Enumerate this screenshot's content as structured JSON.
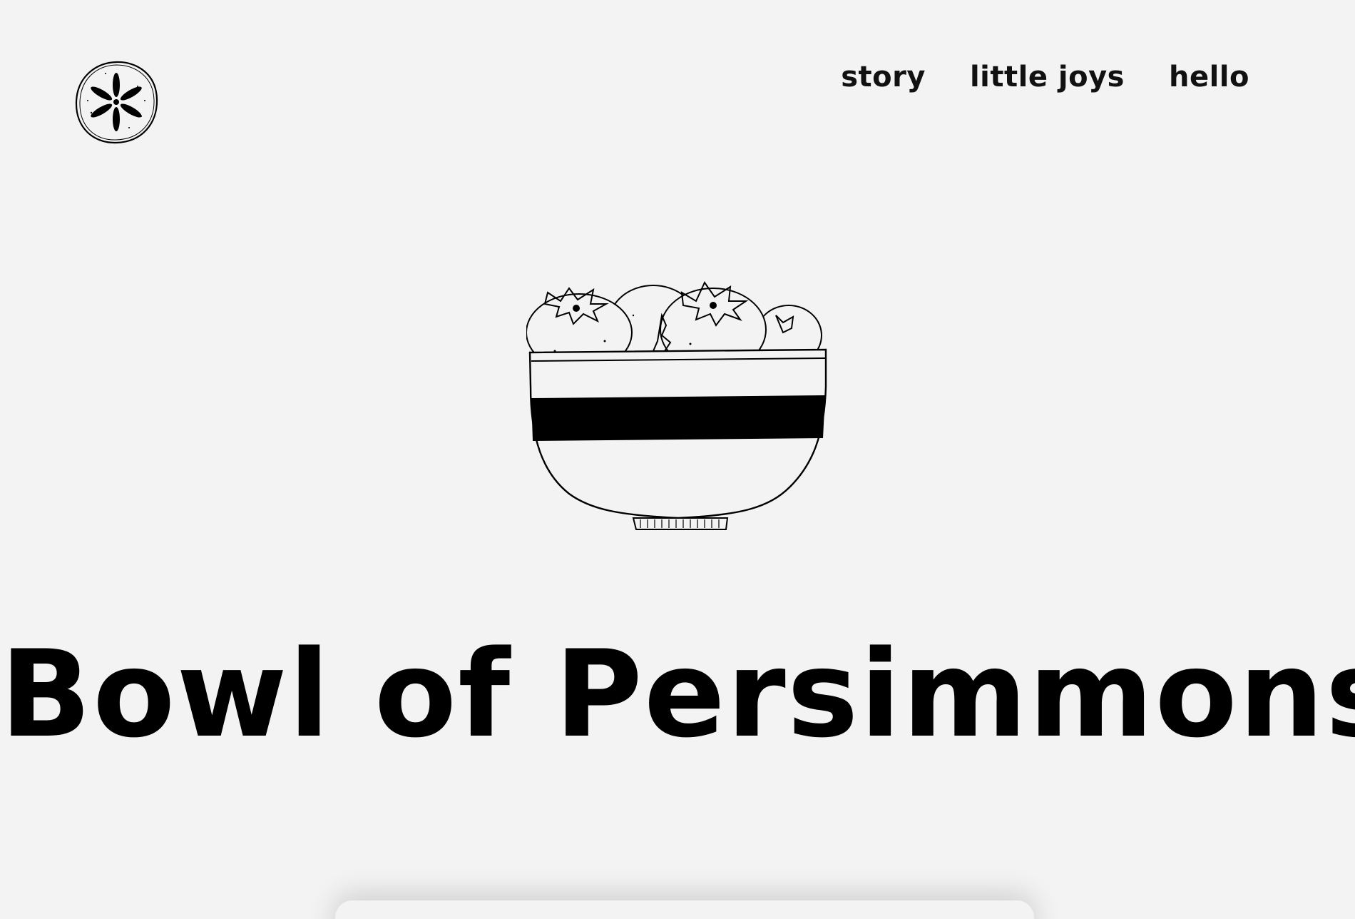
{
  "header": {
    "logo_icon": "persimmon-slice-logo-icon",
    "nav": [
      {
        "label": "story"
      },
      {
        "label": "little joys"
      },
      {
        "label": "hello"
      }
    ]
  },
  "hero": {
    "illustration_icon": "bowl-of-persimmons-illustration",
    "title": "Bowl of Persimmons"
  },
  "colors": {
    "background": "#f3f3f3",
    "text": "#000000"
  }
}
